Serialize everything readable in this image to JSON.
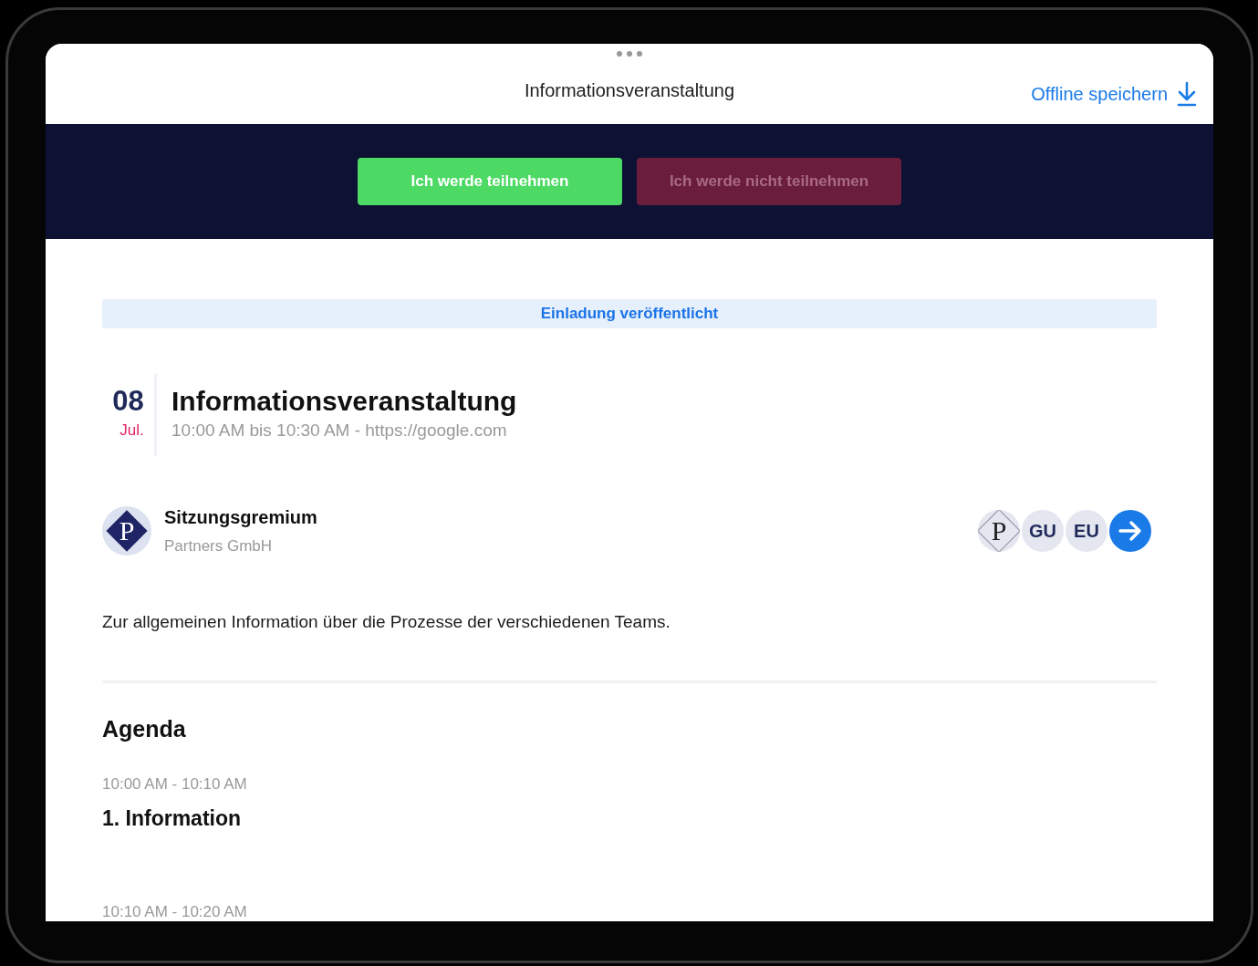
{
  "header": {
    "title": "Informationsveranstaltung",
    "action": "Offline speichern"
  },
  "rsvp_buttons": [
    {
      "label": "Ich werde teilnehmen",
      "kind": "accept",
      "selected": true
    },
    {
      "label": "Ich werde nicht teilnehmen",
      "kind": "decline",
      "selected": false
    }
  ],
  "status_banner": "Einladung veröffentlicht",
  "event": {
    "day": "08",
    "month": "Jul.",
    "title": "Informationsveranstaltung",
    "time": "10:00 AM bis 10:30 AM - https://google.com"
  },
  "organizer": {
    "logo_letter": "P",
    "name": "Sitzungsgremium",
    "company": "Partners GmbH"
  },
  "participants": [
    {
      "kind": "logo",
      "text": "P"
    },
    {
      "kind": "initials",
      "text": "GU"
    },
    {
      "kind": "initials",
      "text": "EU"
    }
  ],
  "description": "Zur allgemeinen Information über die Prozesse der verschiedenen Teams.",
  "agenda": {
    "title": "Agenda",
    "items": [
      {
        "time": "10:00 AM - 10:10 AM",
        "title": "1. Information"
      },
      {
        "time": "10:10 AM - 10:20 AM"
      }
    ]
  }
}
